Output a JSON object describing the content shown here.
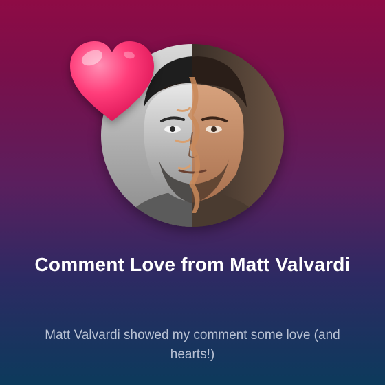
{
  "post": {
    "title": "Comment Love from Matt Valvardi",
    "subtitle": "Matt Valvardi showed my comment some love (and hearts!)"
  },
  "icons": {
    "reaction": "heart-icon",
    "avatar": "profile-photo"
  },
  "colors": {
    "background_top": "#8e0b45",
    "background_bottom": "#0c3a5c",
    "title": "#ffffff",
    "subtitle": "#b9c2d4",
    "heart": "#ff2e6f"
  }
}
